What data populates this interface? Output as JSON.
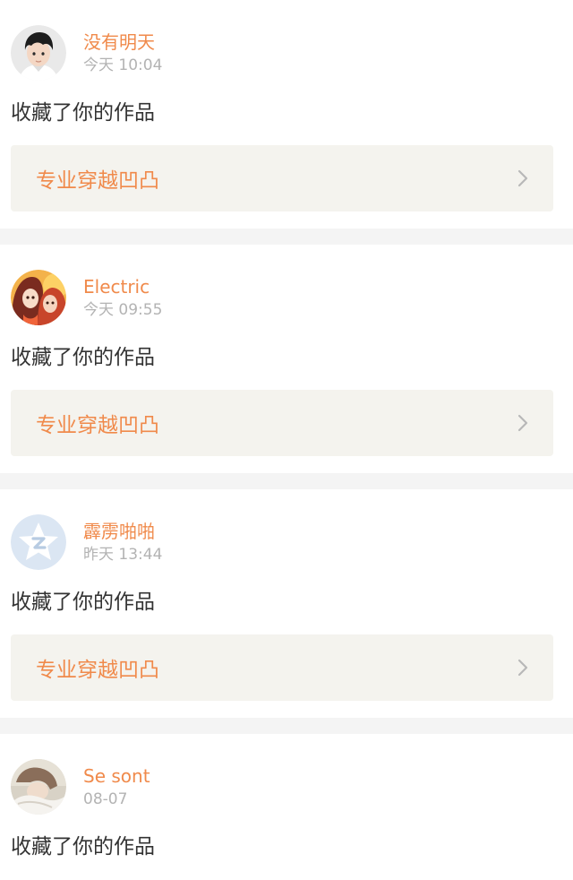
{
  "notifications": [
    {
      "username": "没有明天",
      "time": "今天 10:04",
      "action": "收藏了你的作品",
      "work_title": "专业穿越凹凸",
      "avatar": "avatar-boy-icon"
    },
    {
      "username": "Electric",
      "time": "今天 09:55",
      "action": "收藏了你的作品",
      "work_title": "专业穿越凹凸",
      "avatar": "avatar-anime-icon"
    },
    {
      "username": "霹雳啪啪",
      "time": "昨天 13:44",
      "action": "收藏了你的作品",
      "work_title": "专业穿越凹凸",
      "avatar": "avatar-default-star-icon"
    },
    {
      "username": "Se sont",
      "time": "08-07",
      "action": "收藏了你的作品",
      "avatar": "avatar-photo-icon"
    }
  ],
  "colors": {
    "username": "#f08a4b",
    "timestamp": "#b3b3b3",
    "action_text": "#333333",
    "link_background": "#f4f3ee",
    "page_background": "#f4f4f4"
  }
}
